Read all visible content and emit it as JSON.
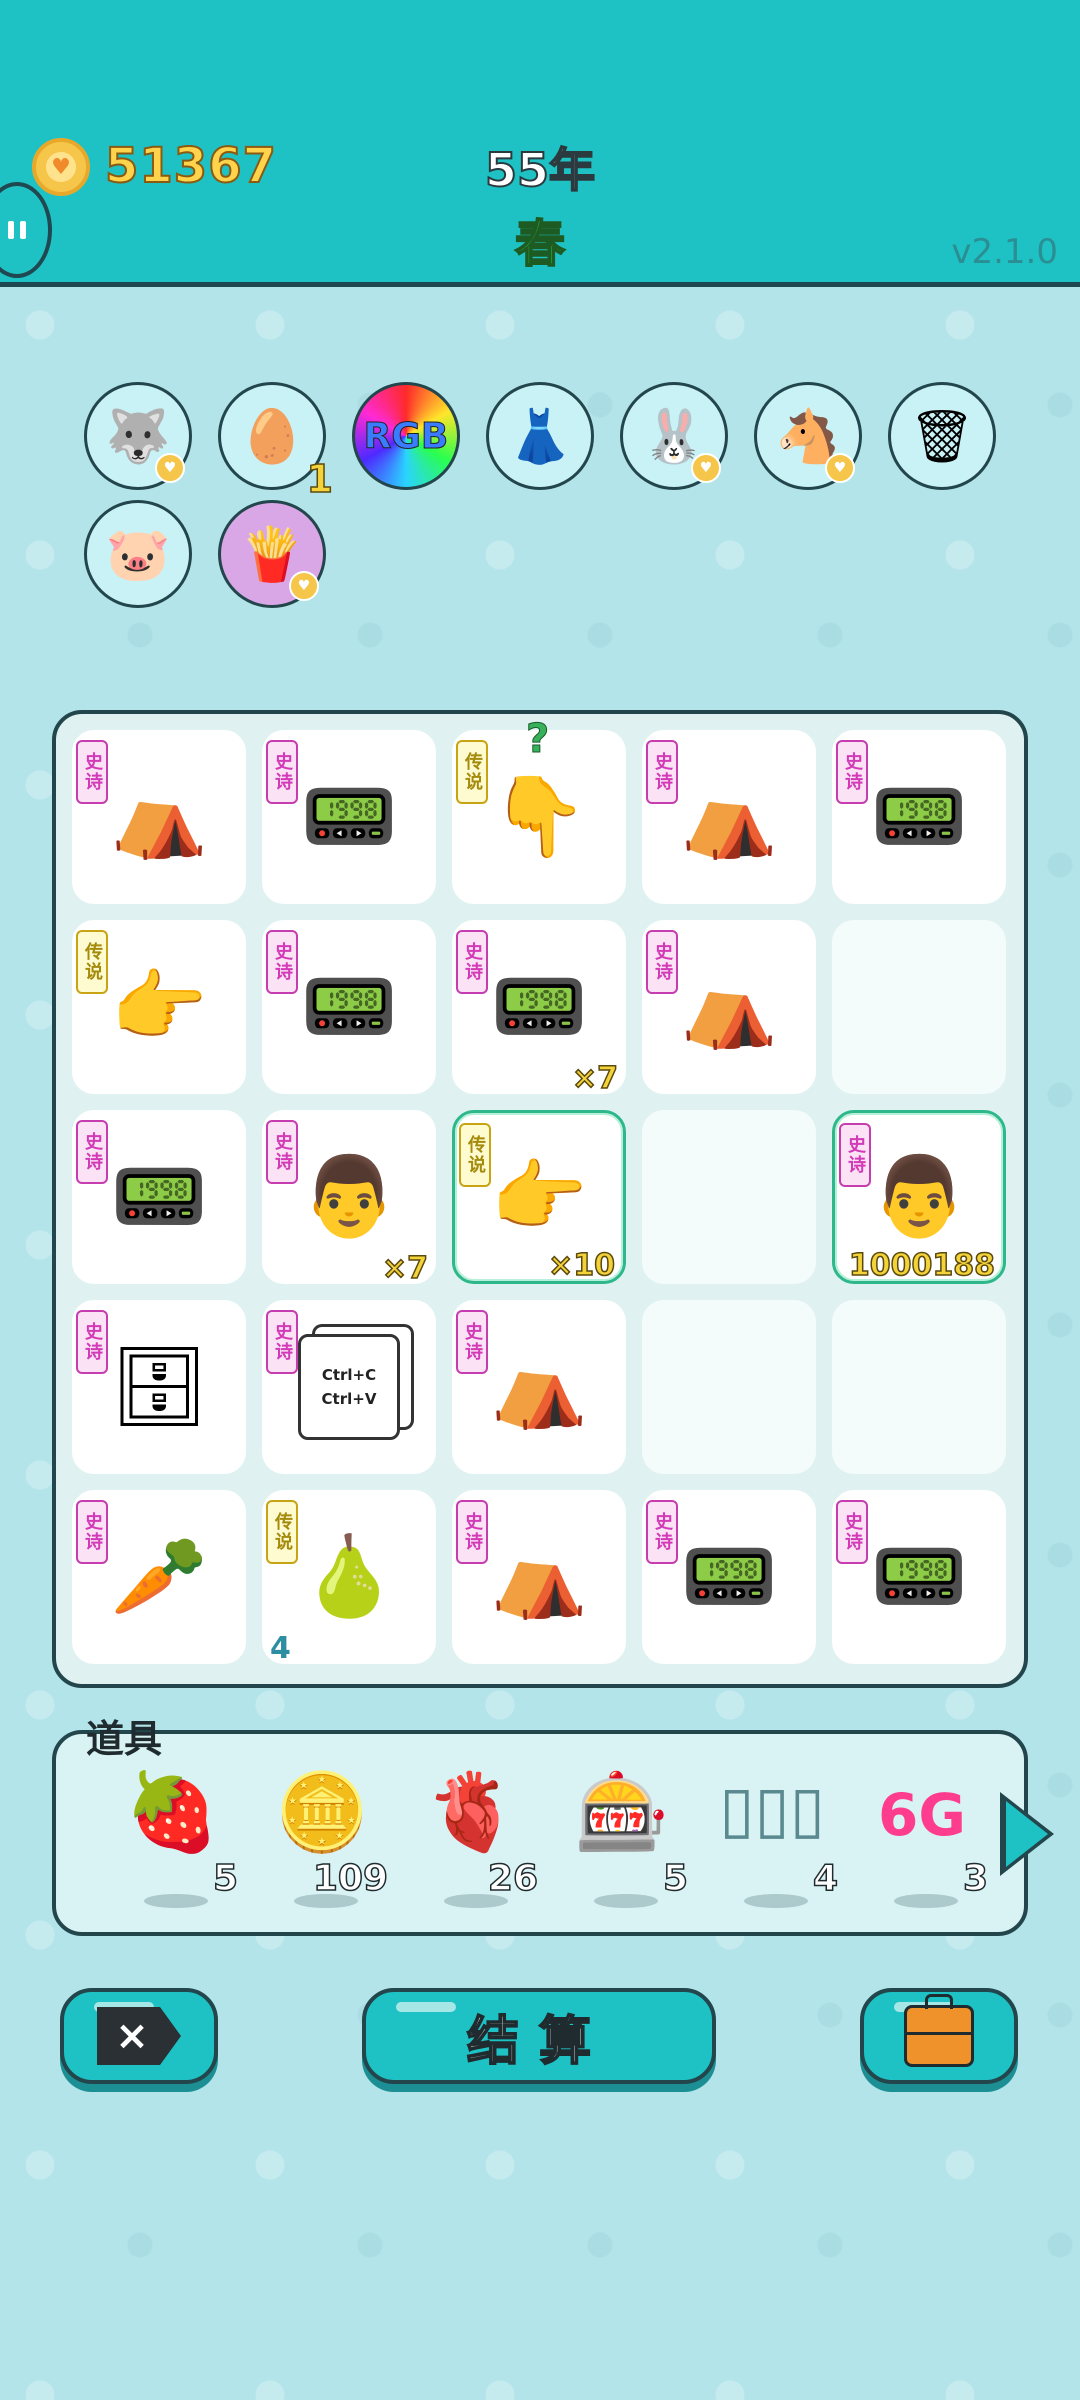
{
  "header": {
    "coins": "51367",
    "year": "55年",
    "season": "春",
    "version": "v2.1.0"
  },
  "badges": [
    {
      "name": "husky-badge",
      "icon": "🐺",
      "count": "",
      "heart": true
    },
    {
      "name": "egg-tray-badge",
      "icon": "🥚",
      "count": "1",
      "heart": false
    },
    {
      "name": "rgb-badge",
      "icon": "RGB",
      "count": "",
      "heart": false
    },
    {
      "name": "skirt-badge",
      "icon": "👗",
      "count": "",
      "heart": false
    },
    {
      "name": "rabbit-badge",
      "icon": "🐰",
      "count": "",
      "heart": true
    },
    {
      "name": "horses-badge",
      "icon": "🐴",
      "count": "",
      "heart": true
    },
    {
      "name": "trash-bag-badge",
      "icon": "🗑",
      "count": "",
      "heart": false
    },
    {
      "name": "piggy-bank-badge",
      "icon": "🐷",
      "count": "",
      "heart": false
    },
    {
      "name": "fries-badge",
      "icon": "🍟",
      "count": "",
      "heart": true
    }
  ],
  "tags": {
    "epic": "史诗",
    "legend": "传说"
  },
  "board": [
    {
      "item": "rabbit-tent",
      "icon": "⛺",
      "tag": "epic",
      "qty": ""
    },
    {
      "item": "graphics-card",
      "icon": "📟",
      "tag": "epic",
      "qty": ""
    },
    {
      "item": "pointing-hand",
      "icon": "👇",
      "tag": "legend",
      "qty": "",
      "question": "?"
    },
    {
      "item": "rabbit-tent",
      "icon": "⛺",
      "tag": "epic",
      "qty": ""
    },
    {
      "item": "graphics-card",
      "icon": "📟",
      "tag": "epic",
      "qty": ""
    },
    {
      "item": "pointing-hand",
      "icon": "👉",
      "tag": "legend",
      "qty": ""
    },
    {
      "item": "graphics-card",
      "icon": "📟",
      "tag": "epic",
      "qty": ""
    },
    {
      "item": "graphics-card",
      "icon": "📟",
      "tag": "epic",
      "qty": "×7"
    },
    {
      "item": "rabbit-tent",
      "icon": "⛺",
      "tag": "epic",
      "qty": ""
    },
    {
      "item": "empty",
      "icon": "",
      "tag": "",
      "qty": ""
    },
    {
      "item": "graphics-card",
      "icon": "📟",
      "tag": "epic",
      "qty": ""
    },
    {
      "item": "bearded-man",
      "icon": "👨",
      "tag": "epic",
      "qty": "×7"
    },
    {
      "item": "pointing-hand",
      "icon": "👉",
      "tag": "legend",
      "qty": "×10",
      "selected": true
    },
    {
      "item": "empty",
      "icon": "",
      "tag": "",
      "qty": ""
    },
    {
      "item": "bearded-man",
      "icon": "👨",
      "tag": "epic",
      "qty": "1000188",
      "selected": true
    },
    {
      "item": "server-rack",
      "icon": "🗄",
      "tag": "epic",
      "qty": ""
    },
    {
      "item": "copy-paste-card",
      "icon": "ctrl",
      "tag": "epic",
      "qty": "",
      "line1": "Ctrl+C",
      "line2": "Ctrl+V"
    },
    {
      "item": "rabbit-tent",
      "icon": "⛺",
      "tag": "epic",
      "qty": ""
    },
    {
      "item": "empty",
      "icon": "",
      "tag": "",
      "qty": ""
    },
    {
      "item": "empty",
      "icon": "",
      "tag": "",
      "qty": ""
    },
    {
      "item": "carrot",
      "icon": "🥕",
      "tag": "epic",
      "qty": ""
    },
    {
      "item": "pear",
      "icon": "🍐",
      "tag": "legend",
      "qty": "4",
      "qty_left": true
    },
    {
      "item": "rabbit-tent",
      "icon": "⛺",
      "tag": "epic",
      "qty": ""
    },
    {
      "item": "graphics-card",
      "icon": "📟",
      "tag": "epic",
      "qty": ""
    },
    {
      "item": "graphics-card",
      "icon": "📟",
      "tag": "epic",
      "qty": ""
    }
  ],
  "props": {
    "title": "道具",
    "items": [
      {
        "name": "strawberry",
        "icon": "🍓",
        "count": "5"
      },
      {
        "name": "gold-coin",
        "icon": "🪙",
        "count": "109"
      },
      {
        "name": "liver",
        "icon": "🫀",
        "count": "26"
      },
      {
        "name": "slots-full",
        "icon": "🎰",
        "count": "5"
      },
      {
        "name": "slots-empty",
        "icon": "▯▯▯",
        "count": "4"
      },
      {
        "name": "6g",
        "icon": "6G",
        "count": "3"
      }
    ]
  },
  "buttons": {
    "delete": "×",
    "settle": "结算",
    "bag": ""
  }
}
